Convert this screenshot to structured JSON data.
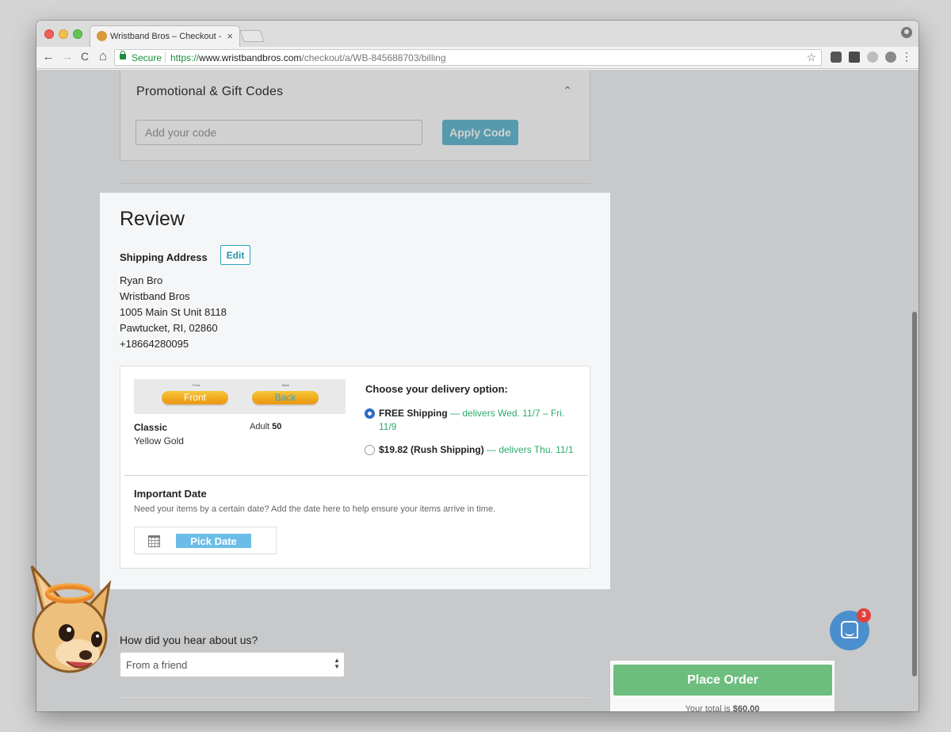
{
  "browser": {
    "tab_title": "Wristband Bros – Checkout - P",
    "tab_close": "×",
    "secure_label": "Secure",
    "url_protocol": "https://",
    "url_host": "www.wristbandbros.com",
    "url_path": "/checkout/a/WB-845688703/billing",
    "back": "←",
    "forward": "→",
    "reload": "C",
    "home": "⌂",
    "star": "☆",
    "menu": "⋮"
  },
  "promo": {
    "title": "Promotional & Gift Codes",
    "chevron": "⌃",
    "input_placeholder": "Add your code",
    "apply_label": "Apply Code"
  },
  "review": {
    "title": "Review",
    "shipping_label": "Shipping Address",
    "edit_label": "Edit",
    "address": [
      "Ryan Bro",
      "Wristband Bros",
      "1005 Main St Unit 8118",
      "Pawtucket, RI, 02860",
      "+18664280095"
    ]
  },
  "order": {
    "front_caption": "Front",
    "back_caption": "Back",
    "front_label": "Front",
    "back_label": "Back",
    "style": "Classic",
    "color": "Yellow Gold",
    "qty_label": "Adult",
    "qty_value": "50",
    "delivery_title": "Choose your delivery option:",
    "options": [
      {
        "label": "FREE Shipping",
        "detail": "— delivers Wed. 11/7 – Fri.",
        "detail2": "11/9",
        "selected": true
      },
      {
        "label": "$19.82 (Rush Shipping)",
        "detail": "— delivers Thu. 11/1",
        "selected": false
      }
    ],
    "important_title": "Important Date",
    "important_desc": "Need your items by a certain date? Add the date here to help ensure your items arrive in time.",
    "pick_date_label": "Pick Date"
  },
  "survey": {
    "question": "How did you hear about us?",
    "selected": "From a friend"
  },
  "summary": {
    "place_order_label": "Place Order",
    "total_prefix": "Your total is",
    "total_value": "$60.00"
  },
  "chat": {
    "badge_count": "3"
  },
  "colors": {
    "accent": "#6bbcd4",
    "place_order": "#6dbd7e",
    "shipping_green": "#2cab6a",
    "chat": "#4b8ecd"
  }
}
